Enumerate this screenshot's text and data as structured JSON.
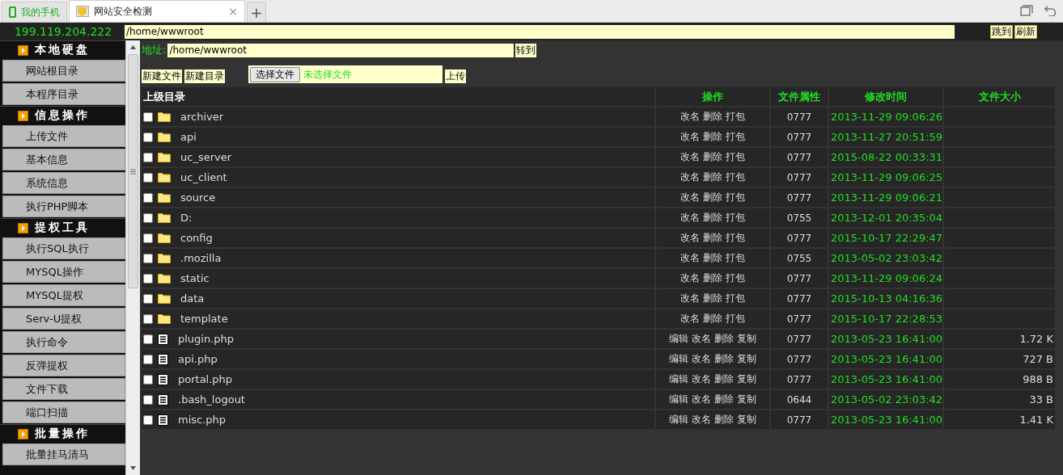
{
  "tabs": [
    {
      "label": "我的手机",
      "selected": false,
      "kind": "phone"
    },
    {
      "label": "网站安全检测",
      "selected": true,
      "kind": "page",
      "close": "×"
    }
  ],
  "new_tab": "+",
  "top_bar": {
    "ip": "199.119.204.222",
    "path": "/home/wwwroot",
    "buttons": [
      "跳到",
      "刷新"
    ]
  },
  "sidebar": [
    {
      "kind": "header",
      "label": "本地硬盘"
    },
    {
      "kind": "item",
      "label": "网站根目录"
    },
    {
      "kind": "item",
      "label": "本程序目录"
    },
    {
      "kind": "header",
      "label": "信息操作"
    },
    {
      "kind": "item",
      "label": "上传文件"
    },
    {
      "kind": "item",
      "label": "基本信息"
    },
    {
      "kind": "item",
      "label": "系统信息"
    },
    {
      "kind": "item",
      "label": "执行PHP脚本"
    },
    {
      "kind": "header",
      "label": "提权工具"
    },
    {
      "kind": "item",
      "label": "执行SQL执行"
    },
    {
      "kind": "item",
      "label": "MYSQL操作"
    },
    {
      "kind": "item",
      "label": "MYSQL提权"
    },
    {
      "kind": "item",
      "label": "Serv-U提权"
    },
    {
      "kind": "item",
      "label": "执行命令"
    },
    {
      "kind": "item",
      "label": "反弹提权"
    },
    {
      "kind": "item",
      "label": "文件下载"
    },
    {
      "kind": "item",
      "label": "端口扫描"
    },
    {
      "kind": "header",
      "label": "批量操作"
    },
    {
      "kind": "item",
      "label": "批量挂马清马"
    }
  ],
  "address": {
    "label": "地址:",
    "value": "/home/wwwroot",
    "button": "转到"
  },
  "actions": {
    "buttons": [
      "新建文件",
      "新建目录"
    ],
    "file_button": "选择文件",
    "file_status": "未选择文件",
    "upload": "上传"
  },
  "table": {
    "columns": [
      "上级目录",
      "操作",
      "文件属性",
      "修改时间",
      "文件大小"
    ],
    "rows": [
      {
        "kind": "folder",
        "checked": false,
        "name": "archiver",
        "ops": "改名 删除 打包",
        "attr": "0777",
        "time": "2013-11-29 09:06:26"
      },
      {
        "kind": "folder",
        "checked": false,
        "name": "api",
        "ops": "改名 删除 打包",
        "attr": "0777",
        "time": "2013-11-27 20:51:59"
      },
      {
        "kind": "folder",
        "checked": false,
        "name": "uc_server",
        "ops": "改名 删除 打包",
        "attr": "0777",
        "time": "2015-08-22 00:33:31"
      },
      {
        "kind": "folder",
        "checked": false,
        "name": "uc_client",
        "ops": "改名 删除 打包",
        "attr": "0777",
        "time": "2013-11-29 09:06:25"
      },
      {
        "kind": "folder",
        "checked": false,
        "name": "source",
        "ops": "改名 删除 打包",
        "attr": "0777",
        "time": "2013-11-29 09:06:21"
      },
      {
        "kind": "folder",
        "checked": false,
        "name": "D:",
        "ops": "改名 删除 打包",
        "attr": "0755",
        "time": "2013-12-01 20:35:04"
      },
      {
        "kind": "folder",
        "checked": false,
        "name": "config",
        "ops": "改名 删除 打包",
        "attr": "0777",
        "time": "2015-10-17 22:29:47"
      },
      {
        "kind": "folder",
        "checked": false,
        "name": ".mozilla",
        "ops": "改名 删除 打包",
        "attr": "0755",
        "time": "2013-05-02 23:03:42"
      },
      {
        "kind": "folder",
        "checked": false,
        "name": "static",
        "ops": "改名 删除 打包",
        "attr": "0777",
        "time": "2013-11-29 09:06:24"
      },
      {
        "kind": "folder",
        "checked": false,
        "name": "data",
        "ops": "改名 删除 打包",
        "attr": "0777",
        "time": "2015-10-13 04:16:36"
      },
      {
        "kind": "folder",
        "checked": false,
        "name": "template",
        "ops": "改名 删除 打包",
        "attr": "0777",
        "time": "2015-10-17 22:28:53"
      },
      {
        "kind": "file",
        "checked": false,
        "name": "plugin.php",
        "ops": "编辑 改名 删除 复制",
        "attr": "0777",
        "time": "2013-05-23 16:41:00",
        "size": "1.72 K"
      },
      {
        "kind": "file",
        "checked": false,
        "name": "api.php",
        "ops": "编辑 改名 删除 复制",
        "attr": "0777",
        "time": "2013-05-23 16:41:00",
        "size": "727 B"
      },
      {
        "kind": "file",
        "checked": false,
        "name": "portal.php",
        "ops": "编辑 改名 删除 复制",
        "attr": "0777",
        "time": "2013-05-23 16:41:00",
        "size": "988 B"
      },
      {
        "kind": "file",
        "checked": false,
        "name": ".bash_logout",
        "ops": "编辑 改名 删除 复制",
        "attr": "0644",
        "time": "2013-05-02 23:03:42",
        "size": "33 B"
      },
      {
        "kind": "file",
        "checked": false,
        "name": "misc.php",
        "ops": "编辑 改名 删除 复制",
        "attr": "0777",
        "time": "2013-05-23 16:41:00",
        "size": "1.41 K"
      }
    ]
  }
}
